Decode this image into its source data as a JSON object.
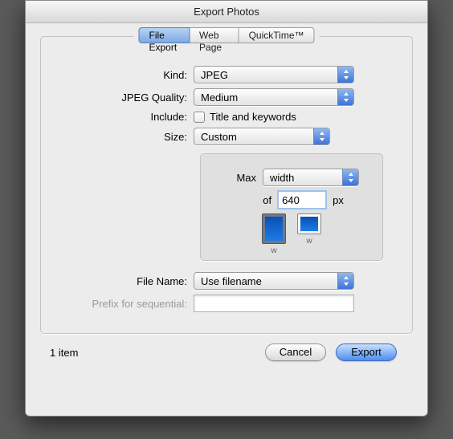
{
  "title": "Export Photos",
  "tabs": [
    "File Export",
    "Web Page",
    "QuickTime™"
  ],
  "labels": {
    "kind": "Kind:",
    "quality": "JPEG Quality:",
    "include": "Include:",
    "include_opt": "Title and keywords",
    "size": "Size:",
    "max": "Max",
    "of": "of",
    "px": "px",
    "w": "w",
    "filename": "File Name:",
    "prefix": "Prefix for sequential:"
  },
  "values": {
    "kind": "JPEG",
    "quality": "Medium",
    "size": "Custom",
    "dim": "width",
    "pixels": "640",
    "filename": "Use filename",
    "prefix": ""
  },
  "footer": {
    "count": "1 item",
    "cancel": "Cancel",
    "export": "Export"
  }
}
